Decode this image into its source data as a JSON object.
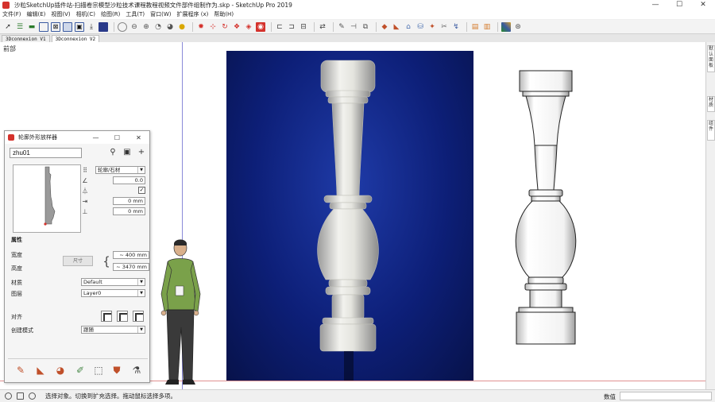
{
  "window": {
    "title": "沙粒SketchUp插件站-扫描卷宗模型沙粒技术课程教程视频文件部件组制作为.skp - SketchUp Pro 2019",
    "minimize": "—",
    "maximize": "☐",
    "close": "✕"
  },
  "menu": [
    "文件(F)",
    "编辑(E)",
    "视图(V)",
    "相机(C)",
    "绘图(R)",
    "工具(T)",
    "窗口(W)",
    "扩展程序 (x)",
    "帮助(H)"
  ],
  "scene_tabs": [
    "3Dconnexion V1",
    "3Dconnexion V2"
  ],
  "viewport": {
    "label": "前部"
  },
  "right_tray": {
    "tabs": [
      "默认面板",
      "材质",
      "组件"
    ]
  },
  "status": {
    "hint": "选择对象。切换到扩充选择。拖动鼠标选择多项。",
    "measure_label": "数值",
    "measure_value": ""
  },
  "dialog": {
    "title": "轮廓外形放样器",
    "name_value": "zhu01",
    "profile_type": "轮廓/石材",
    "field1": "0.0",
    "field2": "0 mm",
    "field3": "0 mm",
    "section_props": "属性",
    "width_label": "宽度",
    "height_label": "高度",
    "dim_button": "尺寸",
    "width_value": "~ 400 mm",
    "height_value": "~ 3470 mm",
    "material_label": "材质",
    "material_value": "Default",
    "layer_label": "图层",
    "layer_value": "Layer0",
    "align_label": "对齐",
    "mode_label": "创建模式",
    "mode_value": "跟随",
    "checkbox_checked": true
  },
  "colors": {
    "photo_bg": "#0d1f78",
    "axis_blue": "#8a8ad8",
    "axis_red": "#e09090",
    "sketchup_red": "#d4322c"
  }
}
